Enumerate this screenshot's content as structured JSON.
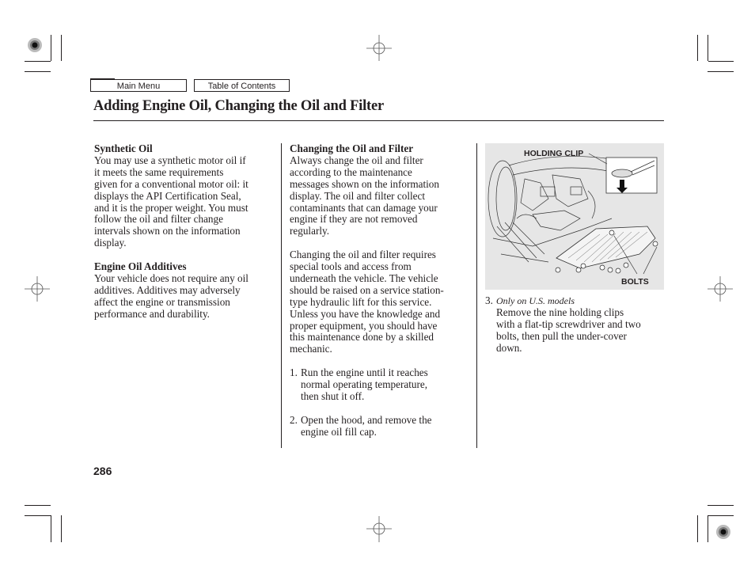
{
  "nav": {
    "main_menu": "Main Menu",
    "table_of_contents": "Table of Contents"
  },
  "page": {
    "title": "Adding Engine Oil, Changing the Oil and Filter",
    "page_number": "286"
  },
  "column1": {
    "synthetic_heading": "Synthetic Oil",
    "synthetic_lines": [
      "You may use a synthetic motor oil if",
      "it meets the same requirements",
      "given for a conventional motor oil: it",
      "displays the API Certification Seal,",
      "and it is the proper weight. You must",
      "follow the oil and filter change",
      "intervals shown on the information",
      "display."
    ],
    "additives_heading": "Engine Oil Additives",
    "additives_lines": [
      "Your vehicle does not require any oil",
      "additives. Additives may adversely",
      "affect the engine or transmission",
      "performance and durability."
    ]
  },
  "column2": {
    "heading": "Changing the Oil and Filter",
    "para1_lines": [
      "Always change the oil and filter",
      "according to the maintenance",
      "messages shown on the information",
      "display. The oil and filter collect",
      "contaminants that can damage your",
      "engine if they are not removed",
      "regularly."
    ],
    "para2_lines": [
      "Changing the oil and filter requires",
      "special tools and access from",
      "underneath the vehicle. The vehicle",
      "should be raised on a service station-",
      "type hydraulic lift for this service.",
      "Unless you have the knowledge and",
      "proper equipment, you should have",
      "this maintenance done by a skilled",
      "mechanic."
    ],
    "steps": [
      {
        "number": "1.",
        "lines": [
          "Run the engine until it reaches",
          "normal operating temperature,",
          "then shut it off."
        ]
      },
      {
        "number": "2.",
        "lines": [
          "Open the hood, and remove the",
          "engine oil fill cap."
        ]
      }
    ]
  },
  "column3": {
    "figure": {
      "label_holding_clip": "HOLDING CLIP",
      "label_bolts": "BOLTS"
    },
    "step": {
      "number": "3.",
      "note": "Only on U.S. models",
      "lines": [
        "Remove the nine holding clips",
        "with a flat-tip screwdriver and two",
        "bolts, then pull the under-cover",
        "down."
      ]
    }
  }
}
